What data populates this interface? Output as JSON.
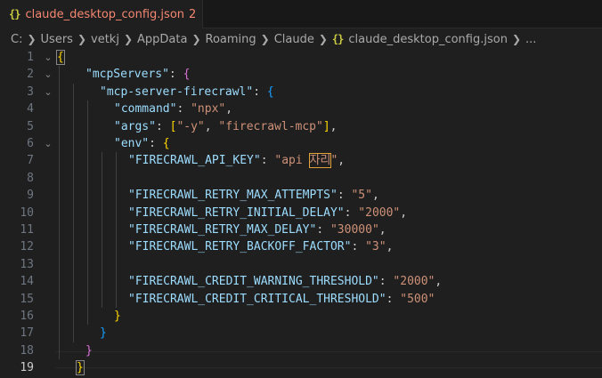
{
  "tab": {
    "icon": "{}",
    "filename": "claude_desktop_config.json",
    "problem_count": "2"
  },
  "breadcrumb": {
    "segments": [
      "C:",
      "Users",
      "vetkj",
      "AppData",
      "Roaming",
      "Claude"
    ],
    "file_icon": "{}",
    "file": "claude_desktop_config.json",
    "more": "..."
  },
  "editor": {
    "line_numbers": [
      "1",
      "2",
      "3",
      "4",
      "5",
      "6",
      "7",
      "8",
      "9",
      "10",
      "11",
      "12",
      "13",
      "14",
      "15",
      "16",
      "17",
      "18",
      "19"
    ],
    "active_line": "19",
    "lines": [
      {
        "text": "{"
      },
      {
        "key": "\"mcpServers\"",
        "punct": ": ",
        "open": "{"
      },
      {
        "key": "\"mcp-server-firecrawl\"",
        "punct": ": ",
        "open": "{"
      },
      {
        "key": "\"command\"",
        "punct": ": ",
        "value": "\"npx\"",
        "tail": ","
      },
      {
        "key": "\"args\"",
        "punct": ": ",
        "open": "[",
        "value1": "\"-y\"",
        "comma": ", ",
        "value2": "\"firecrawl-mcp\"",
        "close": "]",
        "tail": ","
      },
      {
        "key": "\"env\"",
        "punct": ": ",
        "open": "{"
      },
      {
        "key": "\"FIRECRAWL_API_KEY\"",
        "punct": ": ",
        "value_pre": "\"api ",
        "value_hl": "자리",
        "value_post": "\"",
        "tail": ","
      },
      {
        "text": ""
      },
      {
        "key": "\"FIRECRAWL_RETRY_MAX_ATTEMPTS\"",
        "punct": ": ",
        "value": "\"5\"",
        "tail": ","
      },
      {
        "key": "\"FIRECRAWL_RETRY_INITIAL_DELAY\"",
        "punct": ": ",
        "value": "\"2000\"",
        "tail": ","
      },
      {
        "key": "\"FIRECRAWL_RETRY_MAX_DELAY\"",
        "punct": ": ",
        "value": "\"30000\"",
        "tail": ","
      },
      {
        "key": "\"FIRECRAWL_RETRY_BACKOFF_FACTOR\"",
        "punct": ": ",
        "value": "\"3\"",
        "tail": ","
      },
      {
        "text": ""
      },
      {
        "key": "\"FIRECRAWL_CREDIT_WARNING_THRESHOLD\"",
        "punct": ": ",
        "value": "\"2000\"",
        "tail": ","
      },
      {
        "key": "\"FIRECRAWL_CREDIT_CRITICAL_THRESHOLD\"",
        "punct": ": ",
        "value": "\"500\"",
        "tail": ""
      },
      {
        "close": "}"
      },
      {
        "close": "}"
      },
      {
        "close": "}"
      },
      {
        "close": "}"
      }
    ]
  }
}
